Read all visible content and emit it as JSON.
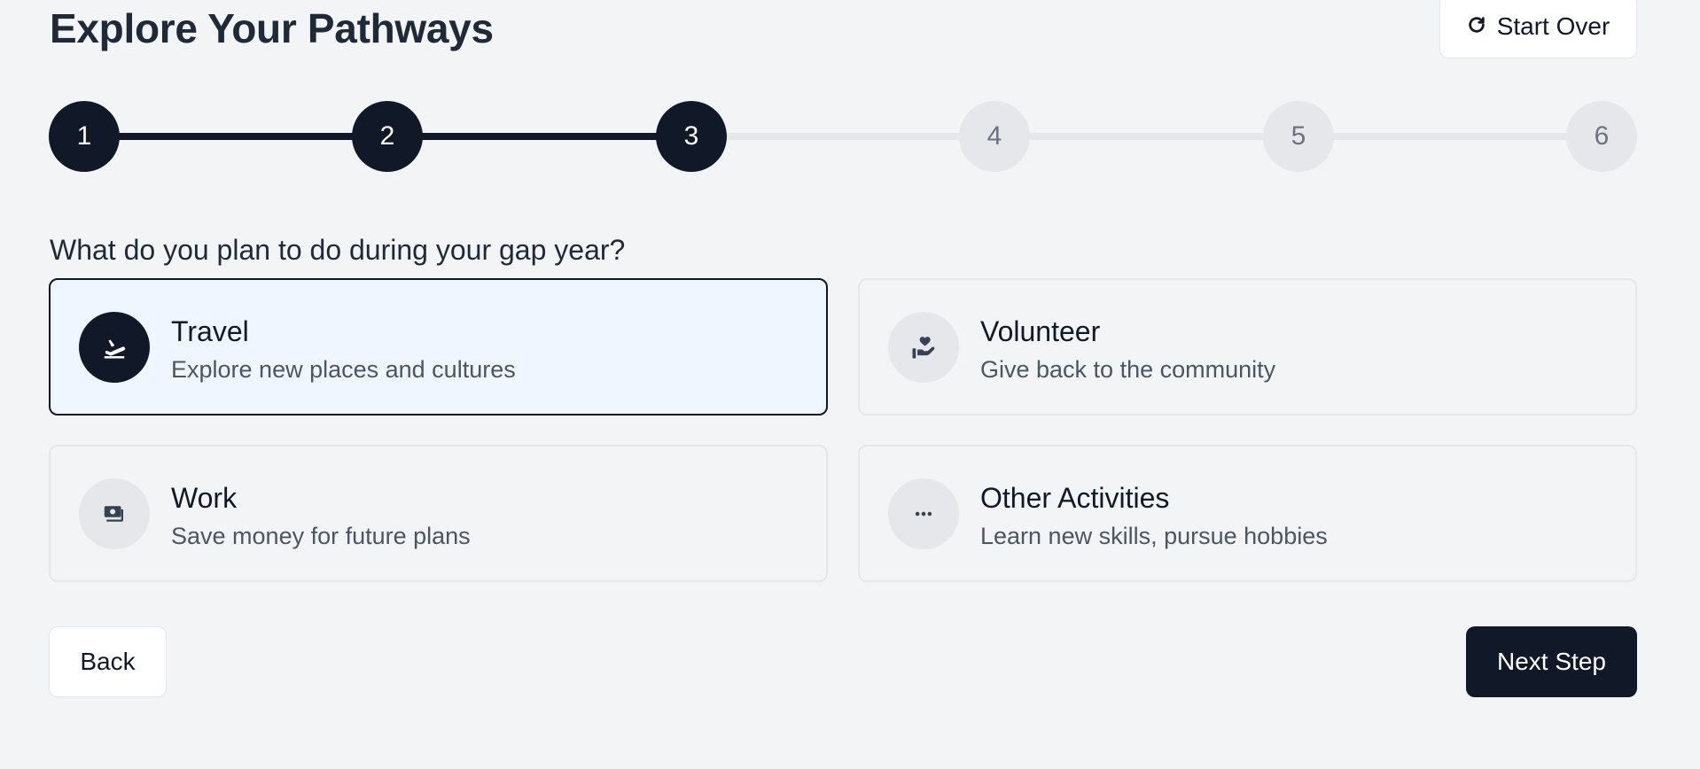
{
  "header": {
    "title": "Explore Your Pathways",
    "start_over_label": "Start Over"
  },
  "stepper": {
    "current_step": 3,
    "total_steps": 6,
    "steps": [
      "1",
      "2",
      "3",
      "4",
      "5",
      "6"
    ]
  },
  "question": "What do you plan to do during your gap year?",
  "options": [
    {
      "title": "Travel",
      "description": "Explore new places and cultures",
      "icon": "plane-departure-icon",
      "selected": true
    },
    {
      "title": "Volunteer",
      "description": "Give back to the community",
      "icon": "hand-holding-heart-icon",
      "selected": false
    },
    {
      "title": "Work",
      "description": "Save money for future plans",
      "icon": "money-bills-icon",
      "selected": false
    },
    {
      "title": "Other Activities",
      "description": "Learn new skills, pursue hobbies",
      "icon": "ellipsis-icon",
      "selected": false
    }
  ],
  "footer": {
    "back_label": "Back",
    "next_label": "Next Step"
  },
  "colors": {
    "primary": "#111827",
    "background": "#f3f4f6",
    "selected_background": "#eff6ff",
    "inactive_step": "#e5e7eb"
  }
}
